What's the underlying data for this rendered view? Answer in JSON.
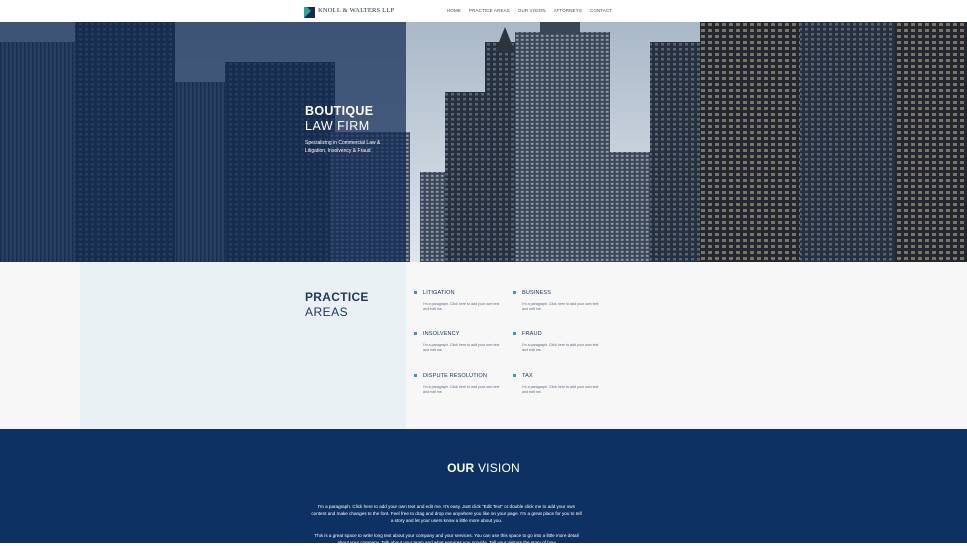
{
  "header": {
    "logo_text": "KNOLL & WALTERS LLP",
    "nav": [
      "HOME",
      "PRACTICE AREAS",
      "OUR VISION",
      "ATTORNEYS",
      "CONTACT"
    ]
  },
  "hero": {
    "title_bold": "BOUTIQUE",
    "title_light": "LAW FIRM",
    "subtitle": "Specializing in Commercial Law & Litigation, Insolvency & Fraud"
  },
  "practice": {
    "title_bold": "PRACTICE",
    "title_light": "AREAS",
    "items": [
      {
        "name": "LITIGATION",
        "desc": "I'm a paragraph. Click here to add your own text and edit me."
      },
      {
        "name": "BUSINESS",
        "desc": "I'm a paragraph. Click here to add your own text and edit me."
      },
      {
        "name": "INSOLVENCY",
        "desc": "I'm a paragraph. Click here to add your own text and edit me."
      },
      {
        "name": "FRAUD",
        "desc": "I'm a paragraph. Click here to add your own text and edit me."
      },
      {
        "name": "DISPUTE RESOLUTION",
        "desc": "I'm a paragraph. Click here to add your own text and edit me."
      },
      {
        "name": "TAX",
        "desc": "I'm a paragraph. Click here to add your own text and edit me."
      }
    ]
  },
  "vision": {
    "title_bold": "OUR",
    "title_light": "VISION",
    "paragraph1": "I'm a paragraph. Click here to add your own text and edit me. It's easy. Just click \"Edit Text\" or double click me to add your own content and make changes to the font. Feel free to drag and drop me anywhere you like on your page. I'm a great place for you to tell a story and let your users know a little more about you.",
    "paragraph2": "This is a great space to write long text about your company and your services. You can use this space to go into a little more detail about your company. Talk about your team and what services you provide. Tell your visitors the story of how"
  },
  "colors": {
    "navy": "#0d3163",
    "accent": "#29a0b8",
    "overlay": "#122d58"
  }
}
